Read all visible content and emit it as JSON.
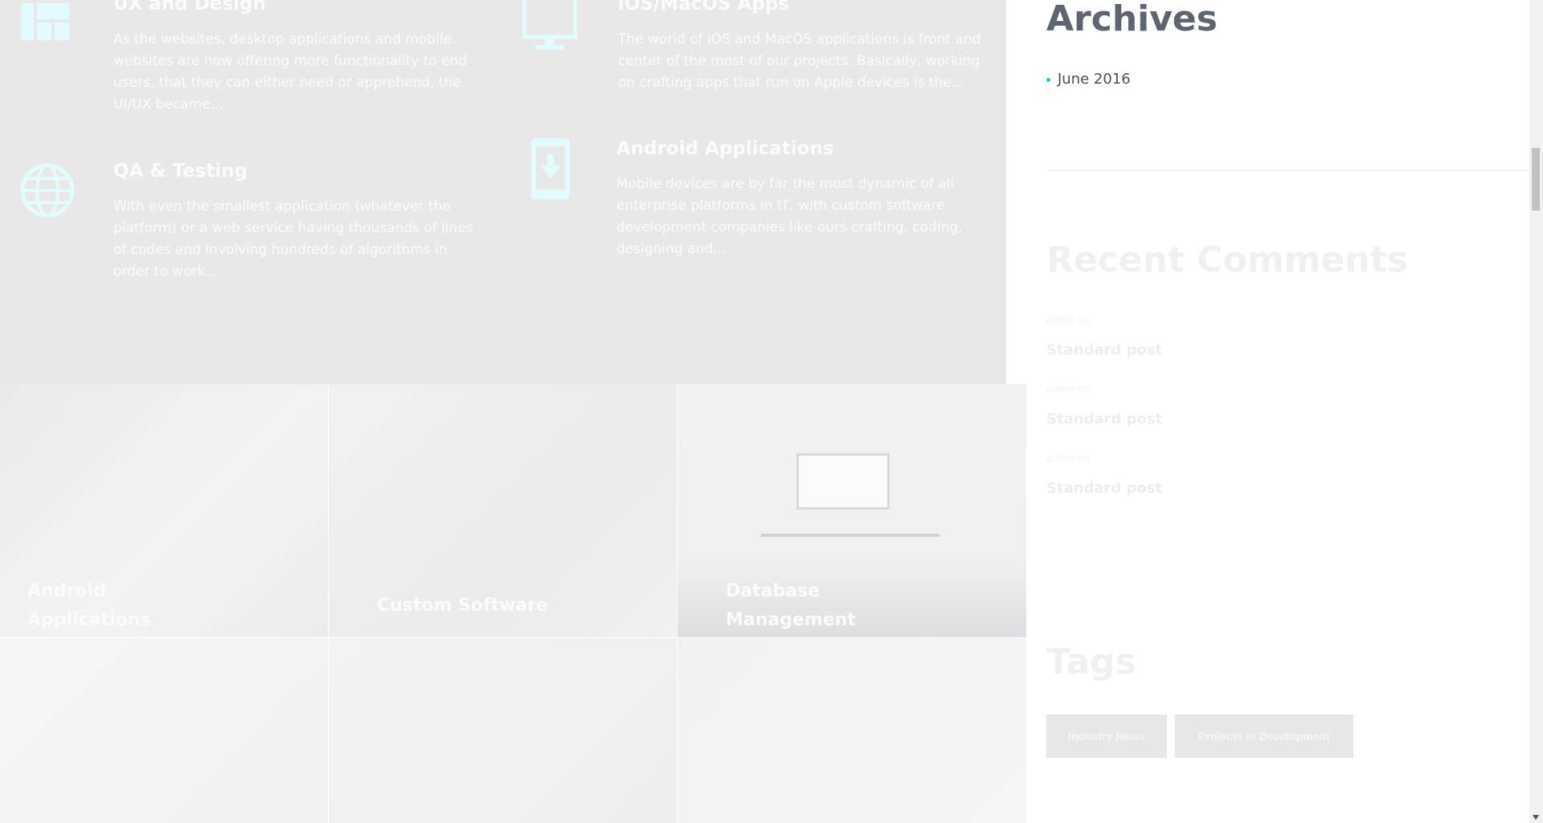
{
  "services": [
    {
      "title": "UX and Design",
      "text": "As the websites, desktop applications and mobile websites are now offering more functionality to end users, that they can either need or apprehend, the UI/UX became...",
      "icon": "layout-icon"
    },
    {
      "title": "iOS/MacOS Apps",
      "text": "The world of iOS and MacOS applications is front and center of the most of our projects. Basically, working on crafting apps that run on Apple devices is the...",
      "icon": "monitor-icon"
    },
    {
      "title": "QA & Testing",
      "text": "With even the smallest application (whatever the platform) or a web service having thousands of lines of codes and involving hundreds of algorithms in order to work...",
      "icon": "globe-icon"
    },
    {
      "title": "Android Applications",
      "text": "Mobile devices are by far the most dynamic of all enterprise platforms in IT, with custom software development companies like ours crafting, coding, designing and...",
      "icon": "download-phone-icon"
    }
  ],
  "tiles": [
    {
      "title": "Android Applications"
    },
    {
      "title": "Custom Software"
    },
    {
      "title": "Database Management"
    }
  ],
  "sidebar": {
    "archives_title": "Archives",
    "archives": [
      "June 2016"
    ],
    "recent_comments_title": "Recent Comments",
    "comments": [
      {
        "meta": "admin on",
        "link": "Standard post"
      },
      {
        "meta": "admin on",
        "link": "Standard post"
      },
      {
        "meta": "admin on",
        "link": "Standard post"
      }
    ],
    "tags_title": "Tags",
    "tags": [
      "Industry News",
      "Projects in Development"
    ]
  },
  "colors": {
    "accent": "#1cc7d0",
    "overlay": "#e8e8e8"
  }
}
